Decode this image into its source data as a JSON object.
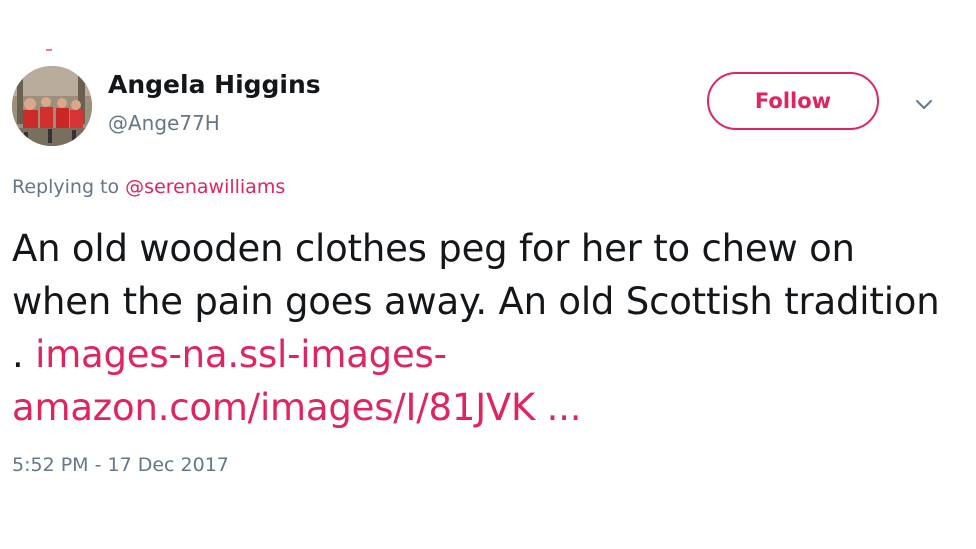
{
  "user": {
    "display_name": "Angela Higgins",
    "handle": "@Ange77H",
    "avatar": "avatar-photo"
  },
  "follow_label": "Follow",
  "menu_icon": "chevron-down-icon",
  "reply": {
    "prefix": "Replying to",
    "mention": "@serenawilliams"
  },
  "tweet": {
    "text": "An old wooden clothes peg for her to chew on when the pain goes away. An old Scottish tradition . ",
    "link": "images-na.ssl-images-amazon.com/images/I/81JVK ..."
  },
  "timestamp": "5:52 PM - 17 Dec 2017",
  "colors": {
    "accent": "#e0245e",
    "secondary_text": "#657786",
    "primary_text": "#14171a"
  }
}
